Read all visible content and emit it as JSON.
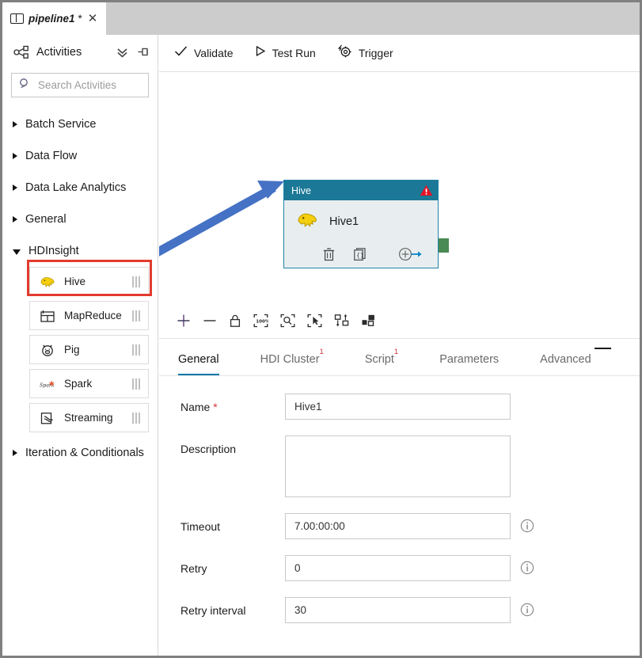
{
  "window": {
    "tab": {
      "title": "pipeline1",
      "dirty_marker": "*",
      "close_label": "✕",
      "icon": "pipeline-icon"
    }
  },
  "activities_panel": {
    "title": "Activities",
    "collapse_all_icon": "double-chevron-down-icon",
    "pin_icon": "pin-icon",
    "share_icon": "activities-share-icon",
    "search": {
      "placeholder": "Search Activities",
      "value": "",
      "icon": "search-icon"
    },
    "groups": [
      {
        "label": "Batch Service",
        "expanded": false
      },
      {
        "label": "Data Flow",
        "expanded": false
      },
      {
        "label": "Data Lake Analytics",
        "expanded": false
      },
      {
        "label": "General",
        "expanded": false
      },
      {
        "label": "HDInsight",
        "expanded": true
      },
      {
        "label": "Iteration & Conditionals",
        "expanded": false
      }
    ],
    "hdinsight_items": [
      {
        "label": "Hive",
        "icon": "hive-elephant-icon",
        "highlighted": true
      },
      {
        "label": "MapReduce",
        "icon": "mapreduce-icon",
        "highlighted": false
      },
      {
        "label": "Pig",
        "icon": "pig-icon",
        "highlighted": false
      },
      {
        "label": "Spark",
        "icon": "spark-icon",
        "highlighted": false
      },
      {
        "label": "Streaming",
        "icon": "streaming-icon",
        "highlighted": false
      }
    ]
  },
  "command_bar": {
    "items": [
      {
        "label": "Validate",
        "icon": "checkmark-icon"
      },
      {
        "label": "Test Run",
        "icon": "play-icon"
      },
      {
        "label": "Trigger",
        "icon": "trigger-gear-icon"
      }
    ]
  },
  "canvas": {
    "node": {
      "header_title": "Hive",
      "name": "Hive1",
      "icon": "hive-elephant-icon",
      "warning_icon": "error-warning-triangle-icon",
      "header_color": "#1b7896",
      "body_color": "#e8eef0",
      "output_handle_color": "#4a8a54",
      "actions": [
        {
          "name": "delete",
          "icon": "trash-icon"
        },
        {
          "name": "code",
          "icon": "code-brackets-icon"
        },
        {
          "name": "add-output",
          "icon": "add-arrow-icon"
        }
      ]
    },
    "annotation": {
      "arrow_color": "#4572c4",
      "highlight_color": "#e23b2e"
    },
    "tools": [
      {
        "name": "zoom-in",
        "icon": "plus-icon"
      },
      {
        "name": "zoom-out",
        "icon": "minus-icon"
      },
      {
        "name": "lock",
        "icon": "lock-icon"
      },
      {
        "name": "zoom-100",
        "icon": "zoom-100-icon"
      },
      {
        "name": "zoom-to-fit",
        "icon": "zoom-fit-icon"
      },
      {
        "name": "select-mode",
        "icon": "cursor-select-icon"
      },
      {
        "name": "auto-align",
        "icon": "auto-align-icon"
      },
      {
        "name": "auto-layout",
        "icon": "auto-layout-icon"
      }
    ]
  },
  "properties": {
    "collapse_icon": "collapse-panel-icon",
    "tabs": [
      {
        "label": "General",
        "badge": "",
        "active": true
      },
      {
        "label": "HDI Cluster",
        "badge": "1",
        "active": false
      },
      {
        "label": "Script",
        "badge": "1",
        "active": false
      },
      {
        "label": "Parameters",
        "badge": "",
        "active": false
      },
      {
        "label": "Advanced",
        "badge": "",
        "active": false
      }
    ],
    "fields": {
      "name": {
        "label": "Name",
        "required": "*",
        "value": "Hive1"
      },
      "description": {
        "label": "Description",
        "value": ""
      },
      "timeout": {
        "label": "Timeout",
        "value": "7.00:00:00",
        "info_icon": "info-icon"
      },
      "retry": {
        "label": "Retry",
        "value": "0",
        "info_icon": "info-icon"
      },
      "retry_interval": {
        "label": "Retry interval",
        "value": "30",
        "info_icon": "info-icon"
      }
    }
  }
}
